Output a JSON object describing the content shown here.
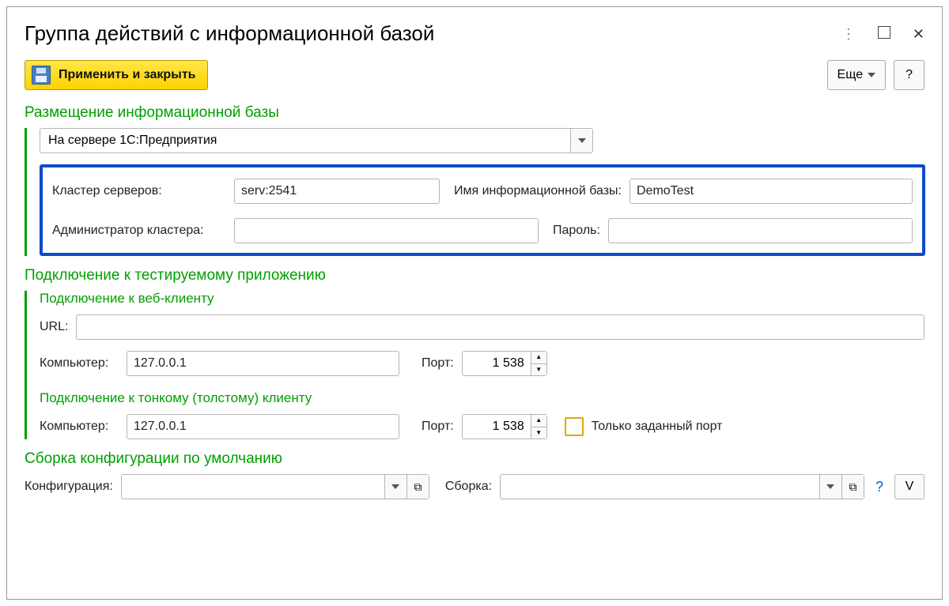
{
  "window_title": "Группа действий с информационной базой",
  "toolbar": {
    "apply_label": "Применить и закрыть",
    "more_label": "Еще",
    "help_label": "?"
  },
  "placement": {
    "heading": "Размещение информационной базы",
    "mode": "На сервере 1С:Предприятия",
    "fields": {
      "cluster_label": "Кластер серверов:",
      "cluster_value": "serv:2541",
      "dbname_label": "Имя информационной базы:",
      "dbname_value": "DemoTest",
      "admin_label": "Администратор кластера:",
      "admin_value": "",
      "password_label": "Пароль:",
      "password_value": ""
    }
  },
  "connection": {
    "heading": "Подключение к тестируемому приложению",
    "web": {
      "heading": "Подключение к веб-клиенту",
      "url_label": "URL:",
      "url_value": "",
      "computer_label": "Компьютер:",
      "computer_value": "127.0.0.1",
      "port_label": "Порт:",
      "port_value": "1 538"
    },
    "thin": {
      "heading": "Подключение к тонкому (толстому) клиенту",
      "computer_label": "Компьютер:",
      "computer_value": "127.0.0.1",
      "port_label": "Порт:",
      "port_value": "1 538",
      "fixed_port_label": "Только заданный порт"
    }
  },
  "build": {
    "heading": "Сборка конфигурации по умолчанию",
    "config_label": "Конфигурация:",
    "config_value": "",
    "assembly_label": "Сборка:",
    "assembly_value": "",
    "v_label": "V"
  }
}
